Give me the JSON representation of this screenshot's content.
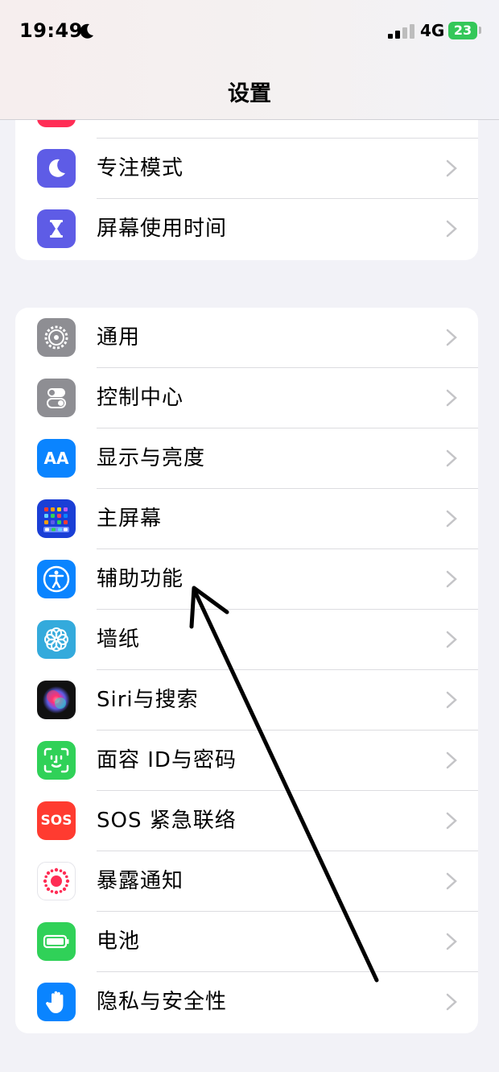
{
  "status_bar": {
    "time": "19:49",
    "network": "4G",
    "battery": "23"
  },
  "nav": {
    "title": "设置"
  },
  "group_top": [
    {
      "label": "专注模式",
      "icon": "focus-moon-icon",
      "color": "#5e5ce6"
    },
    {
      "label": "屏幕使用时间",
      "icon": "screen-time-hourglass-icon",
      "color": "#5e5ce6"
    }
  ],
  "group_main": [
    {
      "label": "通用",
      "icon": "gear-icon",
      "color": "#8e8e93"
    },
    {
      "label": "控制中心",
      "icon": "control-center-icon",
      "color": "#8e8e93"
    },
    {
      "label": "显示与亮度",
      "icon": "display-aa-icon",
      "color": "#0a84ff",
      "icon_text": "AA"
    },
    {
      "label": "主屏幕",
      "icon": "home-screen-icon",
      "color": "#1a3fd6"
    },
    {
      "label": "辅助功能",
      "icon": "accessibility-icon",
      "color": "#0a84ff"
    },
    {
      "label": "墙纸",
      "icon": "wallpaper-flower-icon",
      "color": "#34aadc"
    },
    {
      "label": "Siri与搜索",
      "icon": "siri-icon",
      "color": "#1c1c1e"
    },
    {
      "label": "面容 ID与密码",
      "icon": "face-id-icon",
      "color": "#30d158"
    },
    {
      "label": "SOS 紧急联络",
      "icon": "sos-icon",
      "color": "#ff3b30",
      "icon_text": "SOS"
    },
    {
      "label": "暴露通知",
      "icon": "exposure-notification-icon",
      "color": "#ffffff"
    },
    {
      "label": "电池",
      "icon": "battery-icon",
      "color": "#30d158"
    },
    {
      "label": "隐私与安全性",
      "icon": "privacy-hand-icon",
      "color": "#0a84ff"
    }
  ]
}
